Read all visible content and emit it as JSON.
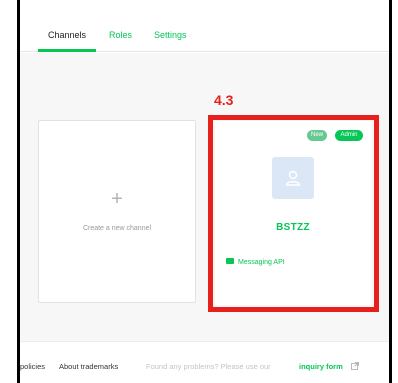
{
  "tabs": [
    {
      "label": "Channels",
      "active": true
    },
    {
      "label": "Roles",
      "active": false
    },
    {
      "label": "Settings",
      "active": false
    }
  ],
  "create_card": {
    "icon": "plus-icon",
    "label": "Create a new channel"
  },
  "annotation": {
    "label": "4.3",
    "color": "#e8201b"
  },
  "channel_card": {
    "badges": [
      "New",
      "Admin"
    ],
    "avatar_icon": "person-icon",
    "name": "BSTZZ",
    "product_icon": "chat-bubble-icon",
    "product": "Messaging API"
  },
  "footer": {
    "policies": "policies",
    "trademarks": "About trademarks",
    "problems": "Found any problems? Please use our",
    "inquiry": "inquiry form",
    "inquiry_icon": "external-link-icon"
  },
  "colors": {
    "accent": "#06c755",
    "badge_new": "#66c98f",
    "avatar_bg": "#dbe7f7"
  }
}
